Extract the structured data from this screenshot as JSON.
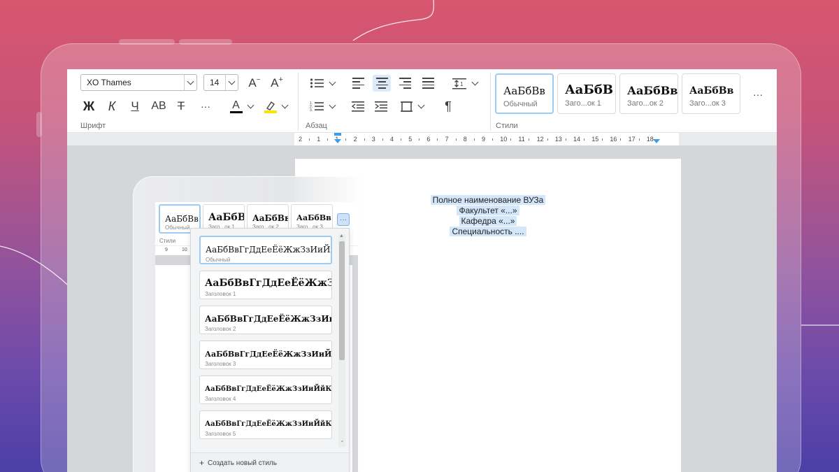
{
  "ribbon": {
    "font_group_label": "Шрифт",
    "paragraph_group_label": "Абзац",
    "styles_group_label": "Стили",
    "font_name": "XO Thames",
    "font_size": "14",
    "grow_font": "A",
    "shrink_font": "A",
    "bold": "Ж",
    "italic": "К",
    "underline": "Ч",
    "small_caps": "AB",
    "strikethrough": "T",
    "more": "···",
    "font_color_glyph": "A",
    "font_color": "#000000",
    "highlight_color": "#f7e500",
    "pilcrow": "¶"
  },
  "style_tiles": [
    {
      "sample": "АаБбВв",
      "name": "Обычный"
    },
    {
      "sample": "АаБбВ",
      "name": "Заго...ок 1"
    },
    {
      "sample": "АаБбВв",
      "name": "Заго...ок 2"
    },
    {
      "sample": "АаБбВв",
      "name": "Заго...ок 3"
    }
  ],
  "styles_more": "···",
  "ruler_labels": [
    "2",
    "1",
    "1",
    "2",
    "3",
    "4",
    "5",
    "6",
    "7",
    "8",
    "9",
    "10",
    "11",
    "12",
    "13",
    "14",
    "15",
    "16",
    "17",
    "18"
  ],
  "document": {
    "lines": [
      "Полное наименование ВУЗа",
      "Факультет «...»",
      "Кафедра «...»",
      "Специальность ...."
    ]
  },
  "inner": {
    "styles_label": "Стили",
    "ruler_labels": [
      "9",
      "10"
    ],
    "mini_tiles": [
      {
        "sample": "АаБбВв",
        "name": "Обычный"
      },
      {
        "sample": "АаБбВ",
        "name": "Заго...ок 1"
      },
      {
        "sample": "АаБбВв",
        "name": "Заго...ок 2"
      },
      {
        "sample": "АаБбВв",
        "name": "Заго...ок 3"
      }
    ],
    "more": "···"
  },
  "style_list": [
    {
      "sample": "АаБбВвГгДдЕеЁёЖжЗзИиЙй",
      "name": "Обычный"
    },
    {
      "sample": "АаБбВвГгДдЕеЁёЖжЗзИ",
      "name": "Заголовок 1"
    },
    {
      "sample": "АаБбВвГгДдЕеЁёЖжЗзИиЙ",
      "name": "Заголовок 2"
    },
    {
      "sample": "АаБбВвГгДдЕеЁёЖжЗзИиЙйК",
      "name": "Заголовок 3"
    },
    {
      "sample": "АаБбВвГгДдЕеЁёЖжЗзИиЙйКкЛ",
      "name": "Заголовок 4"
    },
    {
      "sample": "АаБбВвГгДдЕеЁёЖжЗзИиЙйКкЛл",
      "name": "Заголовок 5"
    }
  ],
  "create_style": "Создать новый стиль",
  "create_style_icon": "+",
  "colors": {
    "accent": "#9ccbf3",
    "selection": "#d3e6fa"
  }
}
